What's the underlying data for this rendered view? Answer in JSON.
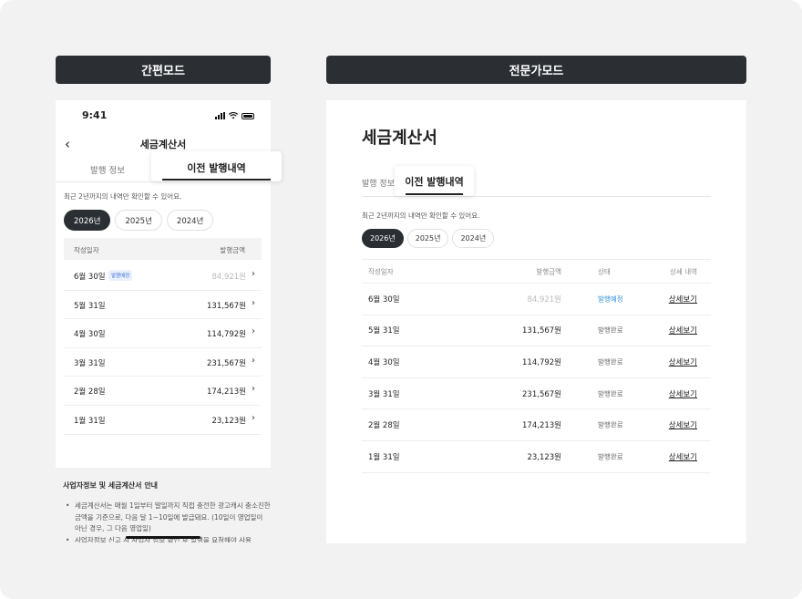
{
  "modes": {
    "simple": "간편모드",
    "expert": "전문가모드"
  },
  "phone": {
    "time": "9:41",
    "title": "세금계산서",
    "tabs": [
      "발행 정보",
      "이전 발행내역"
    ],
    "notice": "최근 2년까지의 내역만 확인할 수 있어요.",
    "years": [
      "2026년",
      "2025년",
      "2024년"
    ],
    "columns": [
      "작성일자",
      "발행금액"
    ],
    "rows": [
      {
        "date": "6월 30일",
        "badge": "발행예정",
        "amount": "84,921원"
      },
      {
        "date": "5월 31일",
        "amount": "131,567원"
      },
      {
        "date": "4월 30일",
        "amount": "114,792원"
      },
      {
        "date": "3월 31일",
        "amount": "231,567원"
      },
      {
        "date": "2월 28일",
        "amount": "174,213원"
      },
      {
        "date": "1월 31일",
        "amount": "23,123원"
      }
    ]
  },
  "guide": {
    "title": "사업자정보 및 세금계산서 안내",
    "items": [
      "세금계산서는 매월 1일부터 말일까지 직접 충전한 광고캐시 충소진한 금액을 기준으로, 다음 달 1~10일에 발급돼요. (10일이 영업일이 아닌 경우, 그 다음 영업일)",
      "사업자정보 신고 시 사업자 정보 확인 후 발행을 요청해야 사용"
    ]
  },
  "expert": {
    "title": "세금계산서",
    "tabs": [
      "발행 정보",
      "이전 발행내역"
    ],
    "notice": "최근 2년까지의 내역만 확인할 수 있어요.",
    "years": [
      "2026년",
      "2025년",
      "2024년"
    ],
    "columns": [
      "작성일자",
      "발행금액",
      "상태",
      "상세 내역"
    ],
    "rows": [
      {
        "date": "6월 30일",
        "amount": "84,921원",
        "status": "발행예정",
        "link": "상세보기"
      },
      {
        "date": "5월 31일",
        "amount": "131,567원",
        "status": "발행완료",
        "link": "상세보기"
      },
      {
        "date": "4월 30일",
        "amount": "114,792원",
        "status": "발행완료",
        "link": "상세보기"
      },
      {
        "date": "3월 31일",
        "amount": "231,567원",
        "status": "발행완료",
        "link": "상세보기"
      },
      {
        "date": "2월 28일",
        "amount": "174,213원",
        "status": "발행완료",
        "link": "상세보기"
      },
      {
        "date": "1월 31일",
        "amount": "23,123원",
        "status": "발행완료",
        "link": "상세보기"
      }
    ]
  },
  "colors": {
    "dark": "#2b2f34",
    "planned": "#2f8fd8",
    "badge": "#3b6fd8"
  }
}
